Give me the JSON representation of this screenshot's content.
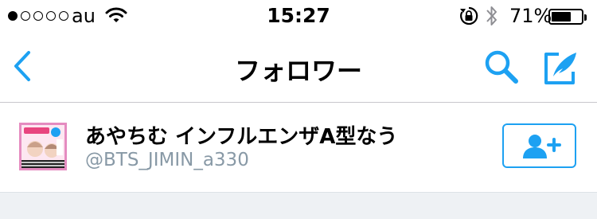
{
  "status_bar": {
    "carrier": "au",
    "time": "15:27",
    "battery_percent": "71%",
    "signal_bars_filled": 1,
    "signal_bars_total": 5,
    "battery_level": 0.71
  },
  "nav": {
    "title": "フォロワー",
    "back_icon": "chevron-left-icon",
    "search_icon": "search-icon",
    "compose_icon": "compose-tweet-icon"
  },
  "followers": [
    {
      "name": "あやちむ インフルエンザA型なう",
      "handle": "@BTS_JIMIN_a330",
      "follow_icon": "follow-user-icon"
    }
  ],
  "colors": {
    "accent": "#1da1f2",
    "handle": "#8899a6",
    "divider": "#c8c7cc",
    "footer_bg": "#eef1f4",
    "avatar_border": "#e58bc0"
  }
}
